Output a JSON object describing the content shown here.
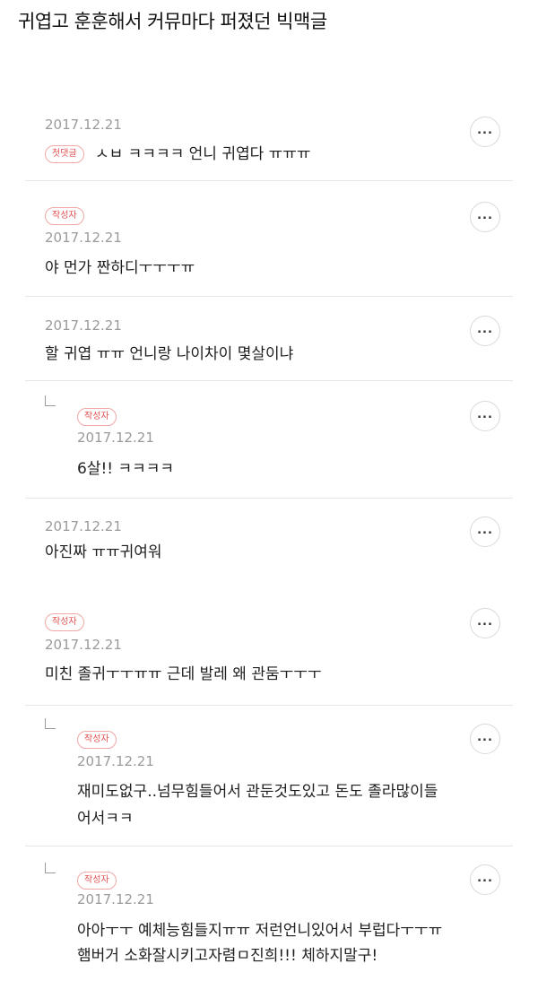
{
  "page": {
    "title": "귀엽고 훈훈해서 커뮤마다 퍼졌던 빅맥글"
  },
  "comments": [
    {
      "badge": "첫댓글",
      "date": "2017.12.21",
      "text": "ㅅㅂ ㅋㅋㅋㅋ 언니 귀엽다 ㅠㅠㅠ",
      "reply": false
    },
    {
      "badge": "작성자",
      "date": "2017.12.21",
      "text": "야 먼가 짠하디ㅜㅜㅜㅠ",
      "reply": false
    },
    {
      "badge": "",
      "date": "2017.12.21",
      "text": "할 귀엽 ㅠㅠ 언니랑 나이차이 몇살이냐",
      "reply": false
    },
    {
      "badge": "작성자",
      "date": "2017.12.21",
      "text": "6살!! ㅋㅋㅋㅋ",
      "reply": true
    },
    {
      "badge": "",
      "date": "2017.12.21",
      "text": "아진짜 ㅠㅠ귀여워",
      "reply": false
    },
    {
      "badge": "작성자",
      "date": "2017.12.21",
      "text": "미친 졸귀ㅜㅜㅠㅠ 근데 발레 왜 관둠ㅜㅜㅜ",
      "reply": false
    },
    {
      "badge": "작성자",
      "date": "2017.12.21",
      "text": "재미도없구..넘무힘들어서 관둔것도있고 돈도 졸라많이들",
      "text2": "어서ㅋㅋ",
      "reply": true
    },
    {
      "badge": "작성자",
      "date": "2017.12.21",
      "text": "아아ㅜㅜ 예체능힘들지ㅠㅠ 저런언니있어서 부럽다ㅜㅜㅠ",
      "text2": "햄버거 소화잘시키고자렴ㅁ진희!!! 체하지말구!",
      "reply": true
    }
  ],
  "more_icon": "more-horizontal-icon",
  "colors": {
    "badge_text": "#e05252",
    "badge_border": "#f0a7a7",
    "date": "#9a9a9a",
    "divider": "#e6e6e6"
  }
}
